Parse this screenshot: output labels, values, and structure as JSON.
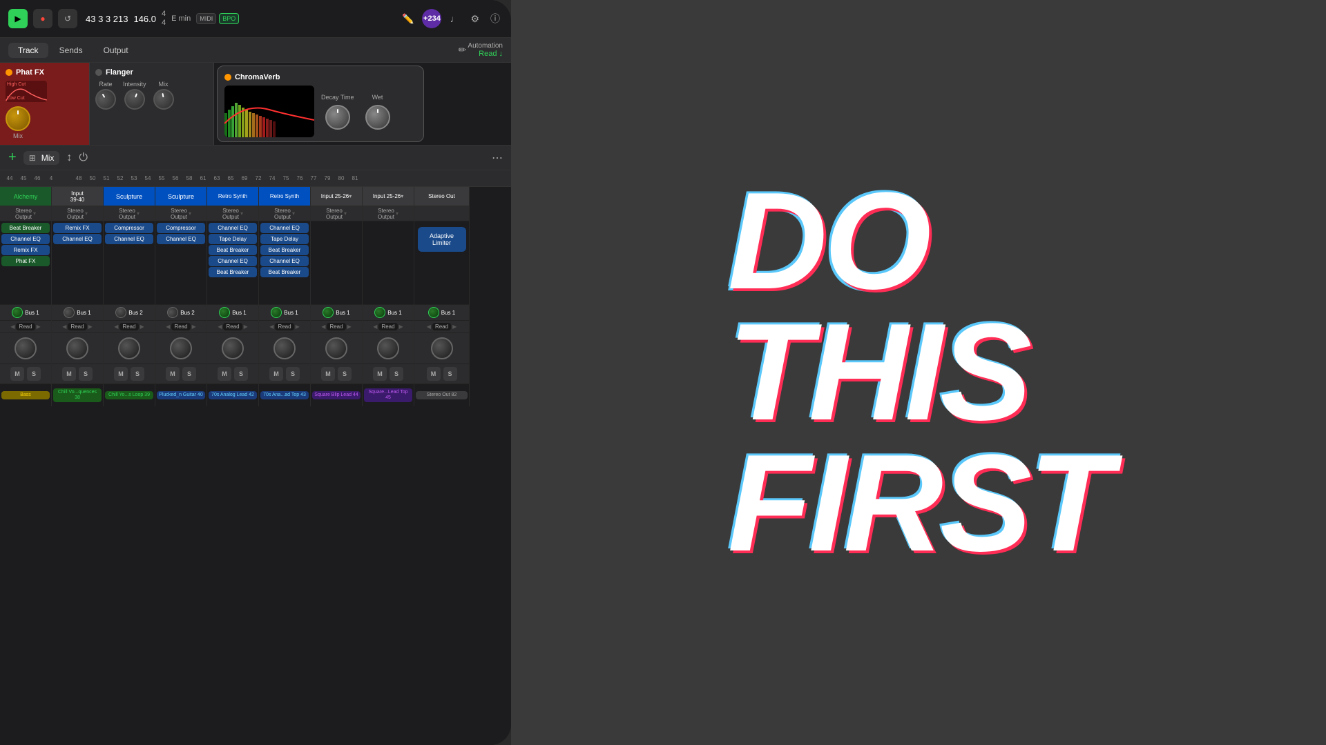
{
  "transport": {
    "play_label": "▶",
    "record_label": "●",
    "cycle_label": "↺",
    "position": "43 3  3 213",
    "tempo": "146.0",
    "time_sig_top": "4",
    "time_sig_bottom": "4",
    "key": "E min",
    "midi_badge": "MIDI",
    "bpm_badge": "BPO",
    "tuner_label": "+234",
    "metronome_icon": "♩"
  },
  "tabs": {
    "track": "Track",
    "sends": "Sends",
    "output": "Output",
    "automation": "Automation",
    "read_label": "Read ↓"
  },
  "fx": {
    "phat_title": "Phat FX",
    "phat_mix": "Mix",
    "phat_high_cut": "High Cut",
    "phat_low_cut": "Low Cut",
    "flanger_title": "Flanger",
    "flanger_rate": "Rate",
    "flanger_intensity": "Intensity",
    "flanger_mix": "Mix",
    "chromaverb_title": "ChromaVerb",
    "chromaverb_decay": "Decay Time",
    "chromaverb_wet": "Wet"
  },
  "mixer": {
    "add_btn": "+",
    "mix_label": "Mix",
    "more_icon": "⋯",
    "grid_icon": "⊞",
    "power_icon": "⏻"
  },
  "channels": [
    {
      "instrument": "Alchemy",
      "output": "Stereo Output",
      "plugins": [
        "Beat Breaker",
        "Channel EQ",
        "Remix FX",
        "Phat FX"
      ],
      "bus": "Bus 1",
      "read": "Read",
      "trackname": "Bass",
      "trackname_class": "tp-yellow"
    },
    {
      "instrument": "Input 39-40",
      "output": "Stereo Output",
      "plugins": [
        "Remix FX",
        "Channel EQ",
        ""
      ],
      "bus": "Bus 1",
      "read": "Read",
      "trackname": "Chill Vo...quences 38",
      "trackname_class": "tp-green"
    },
    {
      "instrument": "Sculpture",
      "output": "Stereo Output",
      "plugins": [
        "Compressor",
        "Channel EQ",
        ""
      ],
      "bus": "Bus 2",
      "read": "Read",
      "trackname": "Chill Yo...s Loop 39",
      "trackname_class": "tp-green"
    },
    {
      "instrument": "Sculpture",
      "output": "Stereo Output",
      "plugins": [
        "Compressor",
        "Channel EQ",
        ""
      ],
      "bus": "Bus 2",
      "read": "Read",
      "trackname": "Plucked_n Guitar 40",
      "trackname_class": "tp-blue"
    },
    {
      "instrument": "Retro Synth",
      "output": "Stereo Output",
      "plugins": [
        "Channel EQ",
        "Tape Delay",
        "Beat Breaker",
        "Channel EQ",
        "Beat Breaker"
      ],
      "bus": "Bus 1",
      "read": "Read",
      "trackname": "70s Analog Lead 42",
      "trackname_class": "tp-blue"
    },
    {
      "instrument": "Retro Synth",
      "output": "Stereo Output",
      "plugins": [
        "Channel EQ",
        "Tape Delay",
        "Beat Breaker",
        "Channel EQ",
        "Beat Breaker"
      ],
      "bus": "Bus 1",
      "read": "Read",
      "trackname": "70s Ana...ad Top 43",
      "trackname_class": "tp-blue"
    },
    {
      "instrument": "Input 25-26",
      "output": "Stereo Output",
      "plugins": [
        "",
        "",
        ""
      ],
      "bus": "Bus 1",
      "read": "Read",
      "trackname": "Square Blip Lead 44",
      "trackname_class": "tp-purple"
    },
    {
      "instrument": "Input 25-26",
      "output": "Stereo Output",
      "plugins": [
        "",
        "",
        ""
      ],
      "bus": "Bus 1",
      "read": "Read",
      "trackname": "Square...Lead Top 45",
      "trackname_class": "tp-purple"
    },
    {
      "instrument": "Stereo Out",
      "output": "",
      "plugins": [
        "Adaptive Limiter"
      ],
      "bus": "Bus 1",
      "read": "Read",
      "trackname": "Stereo Out 82",
      "trackname_class": "tp-gray"
    }
  ],
  "ruler_ticks": [
    "44",
    "45",
    "46",
    "4",
    "",
    "48",
    "",
    "50",
    "",
    "51",
    "",
    "52",
    "53",
    "54",
    "55",
    "56",
    "",
    "58",
    "61",
    "63",
    "65",
    "69",
    "72",
    "",
    "74",
    "75",
    "76",
    "",
    "77",
    "79",
    "80",
    "81"
  ],
  "big_text": {
    "line1": "DO",
    "line2": "THIS",
    "line3": "FIRST"
  }
}
